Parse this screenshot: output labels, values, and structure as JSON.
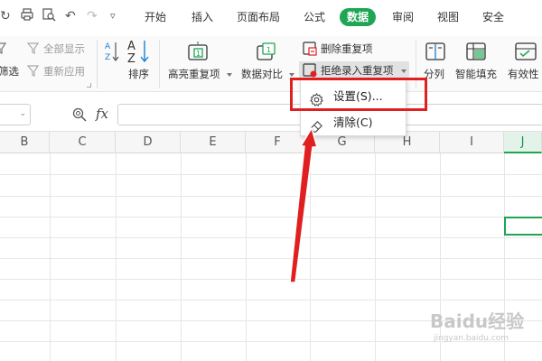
{
  "toolbar": {
    "tabs": [
      "开始",
      "插入",
      "页面布局",
      "公式",
      "数据",
      "审阅",
      "视图",
      "安全"
    ],
    "active_tab": "数据"
  },
  "ribbon": {
    "show_all_label": "全部显示",
    "filter_label": "筛选",
    "reapply_label": "重新应用",
    "sort_label": "排序",
    "highlight_dup_label": "高亮重复项",
    "data_compare_label": "数据对比",
    "delete_dup_label": "删除重复项",
    "reject_dup_label": "拒绝录入重复项",
    "split_col_label": "分列",
    "smart_fill_label": "智能填充",
    "validity_label": "有效性"
  },
  "formula_bar": {
    "fx_label": "fx"
  },
  "grid": {
    "columns": [
      "B",
      "C",
      "D",
      "E",
      "F",
      "G",
      "H",
      "I",
      "J"
    ],
    "selected_column": "J"
  },
  "dropdown": {
    "items": [
      {
        "label": "设置(S)...",
        "icon": "gear-icon"
      },
      {
        "label": "清除(C)",
        "icon": "eraser-icon"
      }
    ]
  },
  "watermark": {
    "text": "Baidu经验",
    "subtext": "jingyan.baidu.com"
  },
  "colors": {
    "accent": "#1fa554",
    "highlight_box": "#e02020",
    "arrow": "#e02020"
  }
}
